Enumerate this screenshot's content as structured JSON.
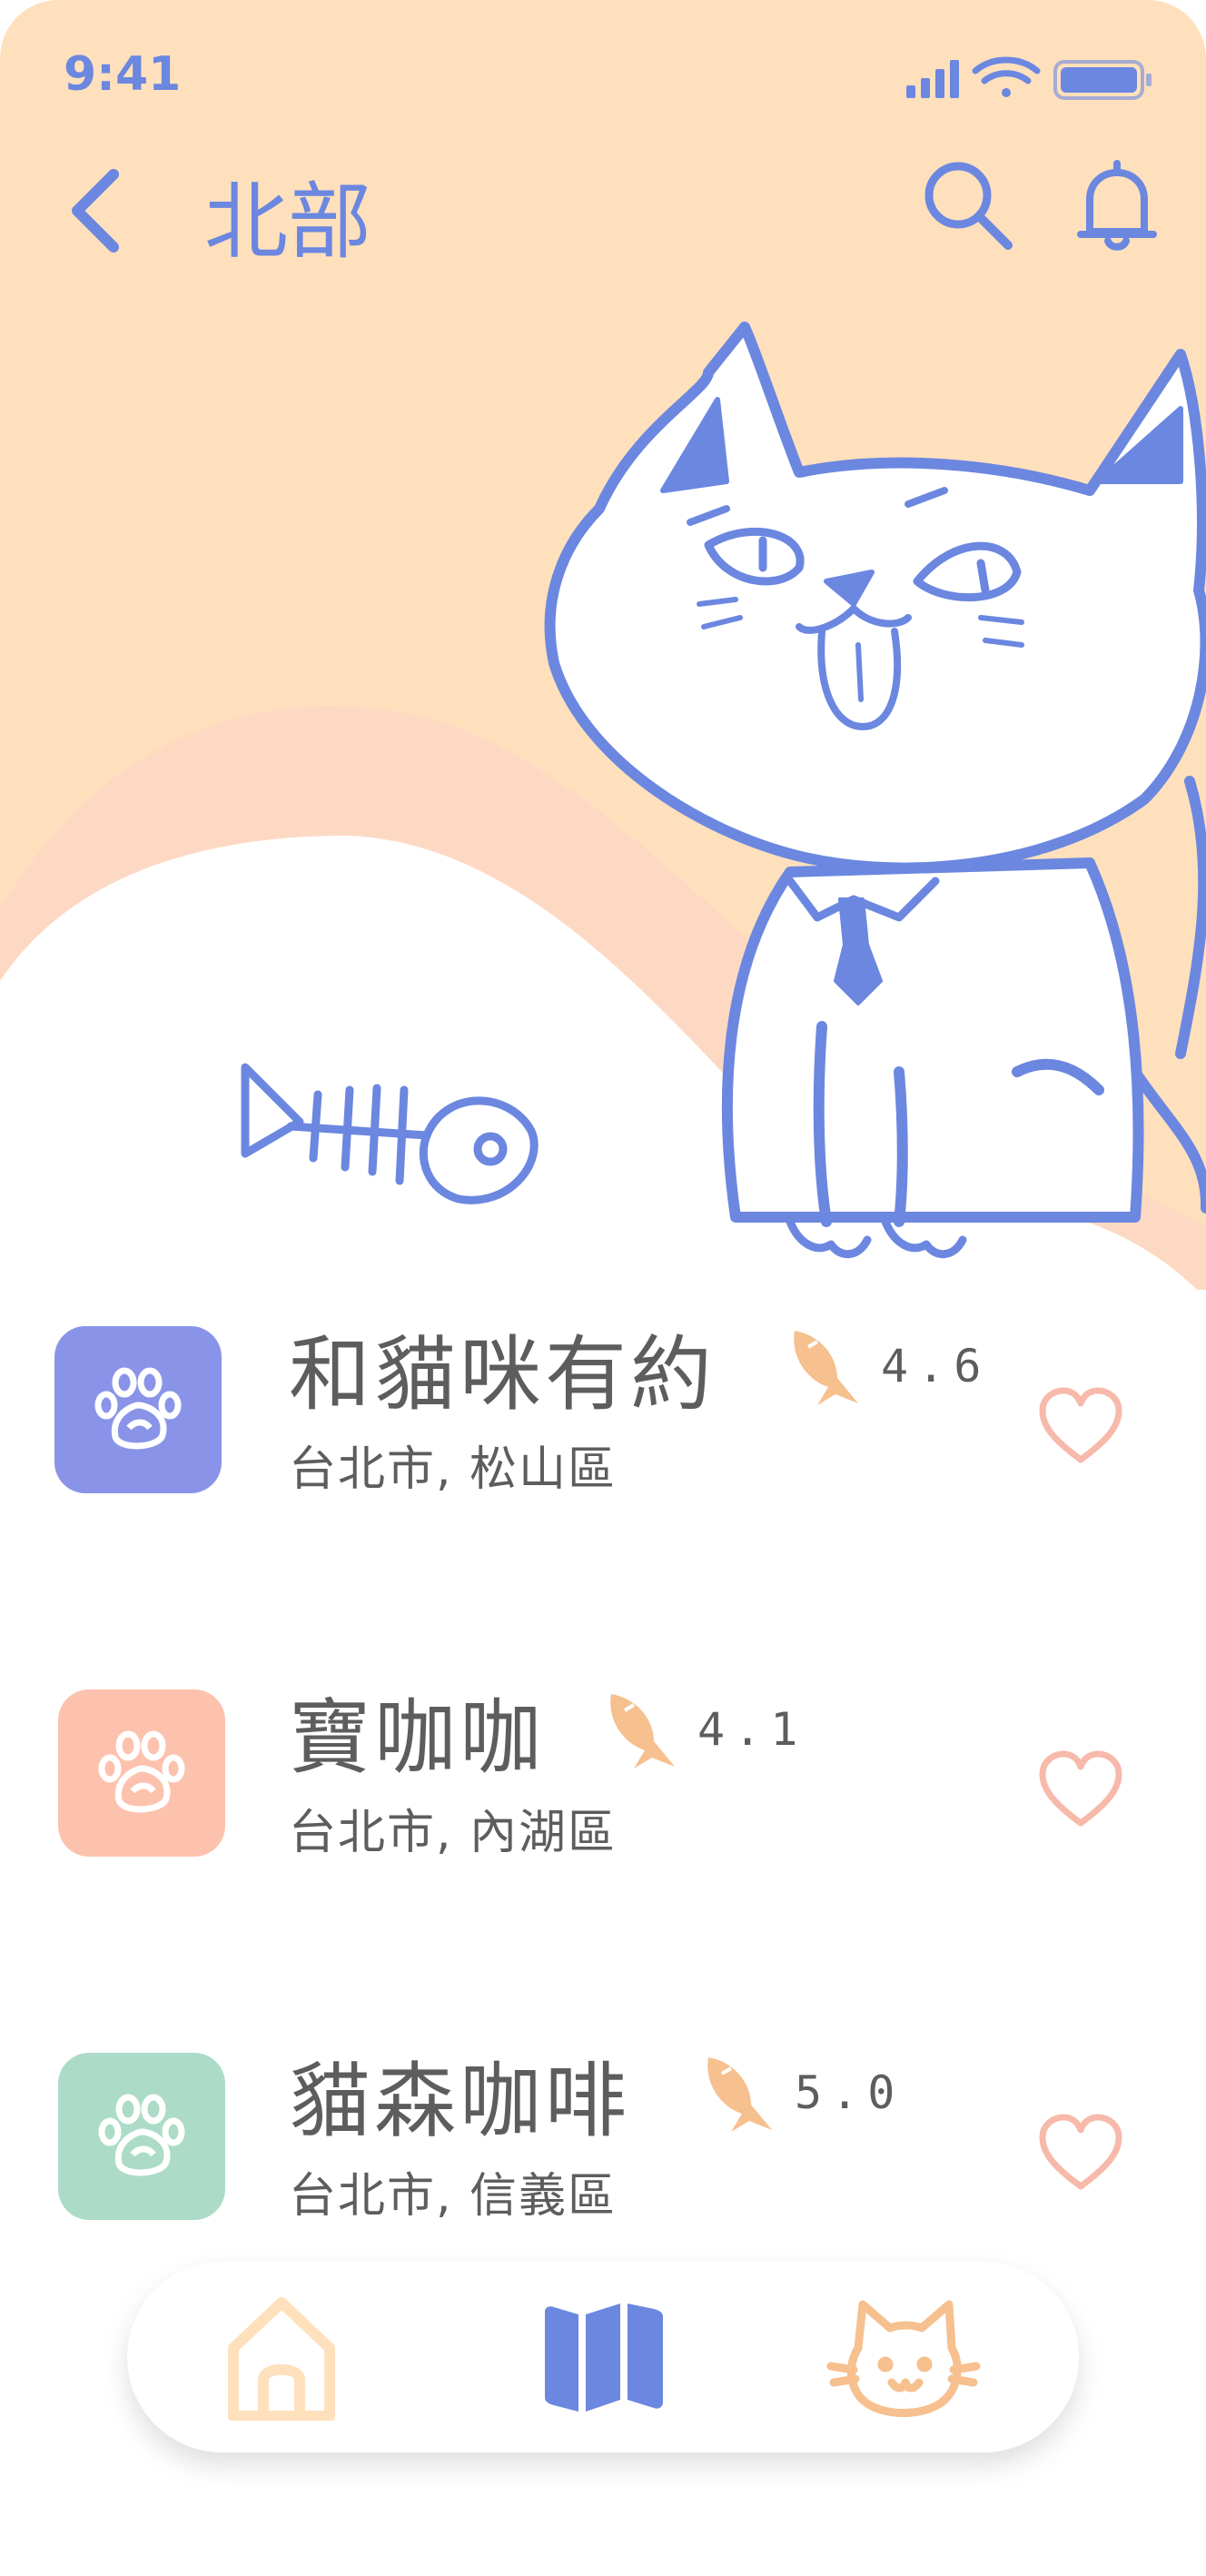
{
  "status_bar": {
    "time": "9:41"
  },
  "header": {
    "title": "北部"
  },
  "colors": {
    "accent": "#6b87e0",
    "peach": "#ffe0bd",
    "wave": "#fdd9c4",
    "fish": "#f6c08f",
    "heart": "#f7b9aa",
    "text": "#5d5d5d"
  },
  "cafes": [
    {
      "name": "和貓咪有約",
      "location": "台北市, 松山區",
      "rating": "4.6",
      "icon_color": "#8994e8",
      "icon": "paw-icon"
    },
    {
      "name": "寶咖咖",
      "location": "台北市, 內湖區",
      "rating": "4.1",
      "icon_color": "#fcc2ad",
      "icon": "paw-icon"
    },
    {
      "name": "貓森咖啡",
      "location": "台北市, 信義區",
      "rating": "5.0",
      "icon_color": "#acdcc7",
      "icon": "paw-icon"
    }
  ],
  "tab_bar": {
    "tabs": [
      {
        "name": "home",
        "icon": "home-icon"
      },
      {
        "name": "map",
        "icon": "map-icon",
        "active": true
      },
      {
        "name": "cat",
        "icon": "cat-icon"
      }
    ]
  }
}
